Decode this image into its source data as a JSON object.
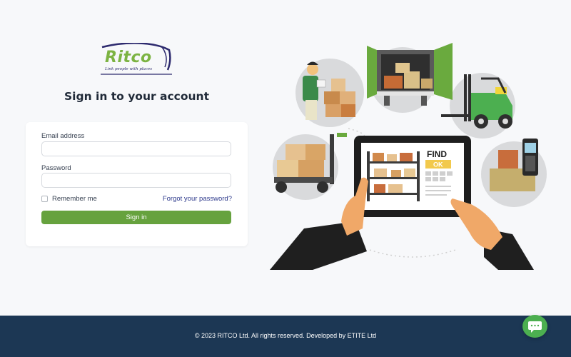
{
  "logo": {
    "word": "Ritco",
    "tagline": "Link people with places"
  },
  "signin_form": {
    "title": "Sign in to your account",
    "email_label": "Email address",
    "email_value": "",
    "password_label": "Password",
    "password_value": "",
    "remember_label": "Remember me",
    "forgot_label": "Forgot your password?",
    "submit_label": "Sign in"
  },
  "illustration": {
    "find_text": "FIND",
    "ok_text": "OK"
  },
  "footer": {
    "text": "© 2023 RITCO Ltd. All rights reserved. Developed by ETITE Ltd"
  },
  "colors": {
    "brand_green": "#66a23e",
    "logo_green": "#7cb342",
    "footer_navy": "#1c3754",
    "chat_green": "#4caf50"
  },
  "icons": {
    "chat": "chat-bubble-icon"
  }
}
